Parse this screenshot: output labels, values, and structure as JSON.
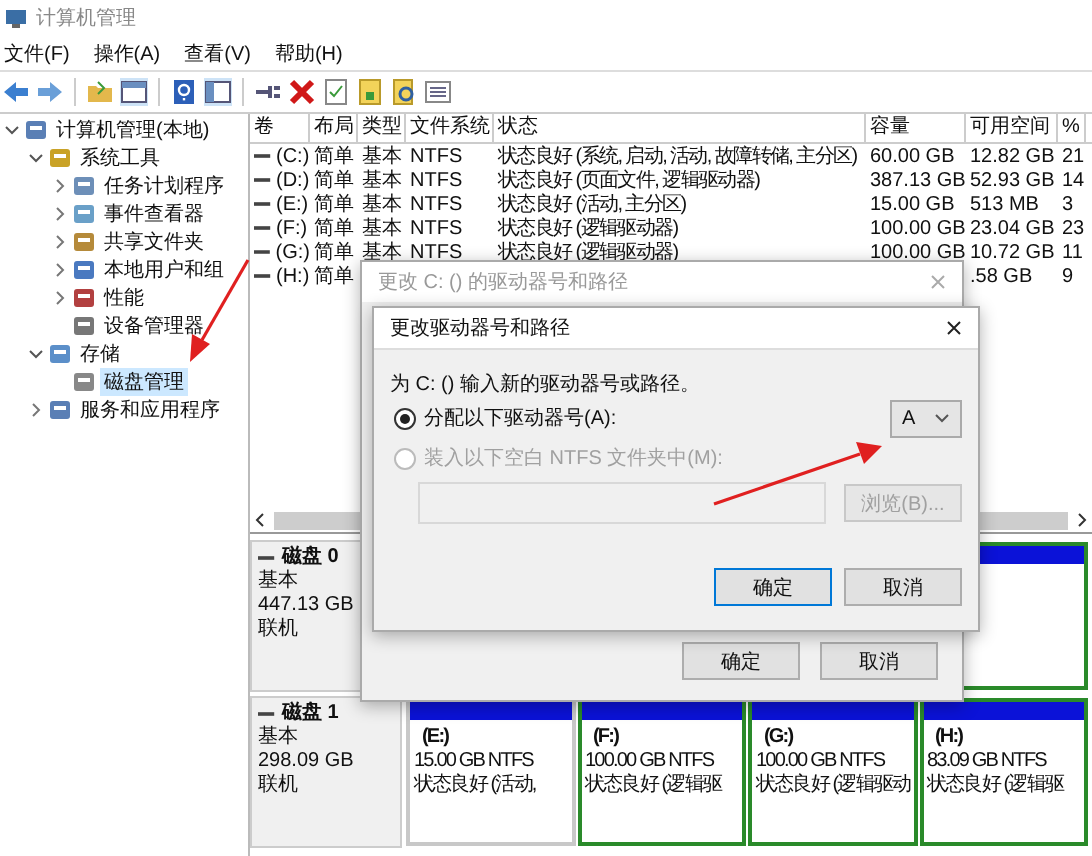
{
  "window": {
    "title": "计算机管理"
  },
  "menu": [
    "文件(F)",
    "操作(A)",
    "查看(V)",
    "帮助(H)"
  ],
  "tree": [
    {
      "label": "计算机管理(本地)",
      "selected": false,
      "expanded": true,
      "children": [
        {
          "label": "系统工具",
          "selected": false,
          "expanded": true,
          "children": [
            {
              "label": "任务计划程序",
              "selected": false,
              "expanded": false
            },
            {
              "label": "事件查看器",
              "selected": false,
              "expanded": false
            },
            {
              "label": "共享文件夹",
              "selected": false,
              "expanded": false
            },
            {
              "label": "本地用户和组",
              "selected": false,
              "expanded": false
            },
            {
              "label": "性能",
              "selected": false,
              "expanded": false
            },
            {
              "label": "设备管理器",
              "selected": false
            }
          ]
        },
        {
          "label": "存储",
          "selected": false,
          "expanded": true,
          "children": [
            {
              "label": "磁盘管理",
              "selected": true
            }
          ]
        },
        {
          "label": "服务和应用程序",
          "selected": false,
          "expanded": false
        }
      ]
    }
  ],
  "volumes": {
    "columns": [
      "卷",
      "布局",
      "类型",
      "文件系统",
      "状态",
      "容量",
      "可用空间",
      "%"
    ],
    "rows": [
      [
        "(C:)",
        "简单",
        "基本",
        "NTFS",
        "状态良好 (系统, 启动, 活动, 故障转储, 主分区)",
        "60.00 GB",
        "12.82 GB",
        "21"
      ],
      [
        "(D:)",
        "简单",
        "基本",
        "NTFS",
        "状态良好 (页面文件, 逻辑驱动器)",
        "387.13 GB",
        "52.93 GB",
        "14"
      ],
      [
        "(E:)",
        "简单",
        "基本",
        "NTFS",
        "状态良好 (活动, 主分区)",
        "15.00 GB",
        "513 MB",
        "3"
      ],
      [
        "(F:)",
        "简单",
        "基本",
        "NTFS",
        "状态良好 (逻辑驱动器)",
        "100.00 GB",
        "23.04 GB",
        "23"
      ],
      [
        "(G:)",
        "简单",
        "基本",
        "NTFS",
        "状态良好 (逻辑驱动器)",
        "100.00 GB",
        "10.72 GB",
        "11"
      ],
      [
        "(H:)",
        "简单",
        "",
        "",
        "",
        "",
        ".58 GB",
        "9"
      ]
    ]
  },
  "disks": [
    {
      "name": "磁盘 0",
      "type": "基本",
      "size": "447.13 GB",
      "status": "联机",
      "partitions": [
        {
          "kind": "logical"
        }
      ]
    },
    {
      "name": "磁盘 1",
      "type": "基本",
      "size": "298.09 GB",
      "status": "联机",
      "partitions": [
        {
          "kind": "primary",
          "label": "(E:)",
          "size": "15.00 GB NTFS",
          "status": "状态良好 (活动,"
        },
        {
          "kind": "logical",
          "label": "(F:)",
          "size": "100.00 GB NTFS",
          "status": "状态良好 (逻辑驱"
        },
        {
          "kind": "logical",
          "label": "(G:)",
          "size": "100.00 GB NTFS",
          "status": "状态良好 (逻辑驱动"
        },
        {
          "kind": "logical",
          "label": "(H:)",
          "size": "83.09 GB NTFS",
          "status": "状态良好 (逻辑驱"
        }
      ]
    }
  ],
  "back_dialog": {
    "title": "更改 C: () 的驱动器号和路径",
    "buttons": [
      "确定",
      "取消"
    ]
  },
  "front_dialog": {
    "title": "更改驱动器号和路径",
    "prompt": "为 C: () 输入新的驱动器号或路径。",
    "options": [
      {
        "label": "分配以下驱动器号(A):",
        "selected": true,
        "disabled": false
      },
      {
        "label": "装入以下空白 NTFS 文件夹中(M):",
        "selected": false,
        "disabled": true
      }
    ],
    "drive_letter": "A",
    "browse_button": {
      "label": "浏览(B)...",
      "disabled": true
    },
    "buttons": [
      "确定",
      "取消"
    ]
  }
}
